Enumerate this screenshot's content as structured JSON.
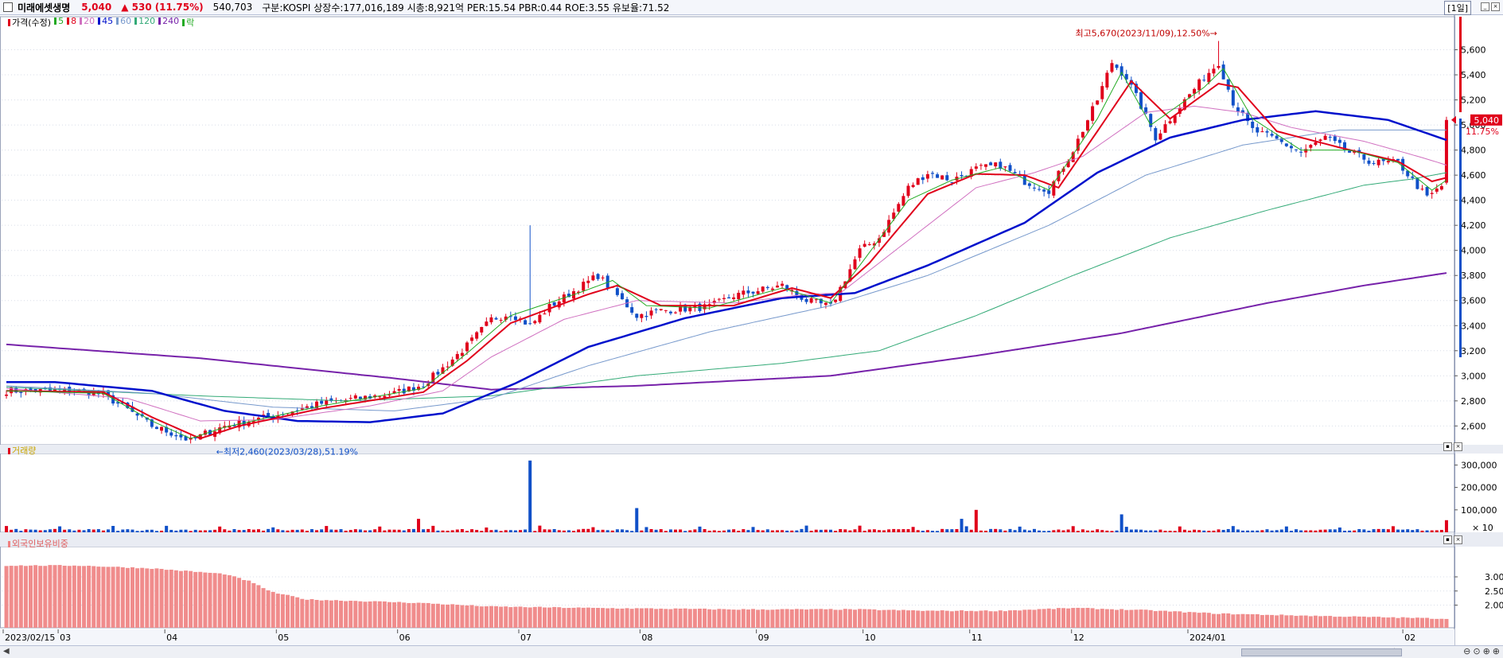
{
  "header": {
    "stock_name": "미래에셋생명",
    "price": "5,040",
    "change": "▲ 530",
    "change_pct": "(11.75%)",
    "volume": "540,703",
    "info": "구분:KOSPI  상장수:177,016,189  시총:8,921억  PER:15.54  PBR:0.44  ROE:3.55  유보율:71.52",
    "period": "[1일]"
  },
  "legend": {
    "price_label": "가격(수정)",
    "ma_items": [
      {
        "label": "5",
        "color": "#22aa22"
      },
      {
        "label": "8",
        "color": "#e0001b"
      },
      {
        "label": "20",
        "color": "#d070c0"
      },
      {
        "label": "45",
        "color": "#0011cc"
      },
      {
        "label": "60",
        "color": "#7799cc"
      },
      {
        "label": "120",
        "color": "#33aa77"
      },
      {
        "label": "240",
        "color": "#7722aa"
      },
      {
        "label": "락",
        "color": "#22aa22"
      }
    ]
  },
  "volume_panel": {
    "label": "거래량",
    "unit_label": "× 10"
  },
  "foreign_panel": {
    "label": "외국인보유비중"
  },
  "colors": {
    "up": "#e0001b",
    "down": "#1050c8",
    "bg": "#ffffff",
    "grid": "#d8dde8"
  },
  "chart_data": {
    "type": "candlestick",
    "x_labels": [
      "2023/02/15",
      "03",
      "04",
      "05",
      "06",
      "07",
      "08",
      "09",
      "10",
      "11",
      "12",
      "2024/01",
      "02"
    ],
    "price_axis": {
      "ylim": [
        2450,
        5800
      ],
      "ticks": [
        "2,600",
        "2,800",
        "3,000",
        "3,200",
        "3,400",
        "3,600",
        "3,800",
        "4,000",
        "4,200",
        "4,400",
        "4,600",
        "4,800",
        "5,000",
        "5,200",
        "5,400",
        "5,600"
      ]
    },
    "current_price": {
      "value": 5040,
      "label": "5,040",
      "pct": "11.75%"
    },
    "annotations": {
      "high": "최고5,670(2023/11/09),12.50%→",
      "low": "←최저2,460(2023/03/28),51.19%"
    },
    "close_anchors": [
      [
        0,
        2880
      ],
      [
        15,
        2880
      ],
      [
        20,
        2850
      ],
      [
        25,
        2730
      ],
      [
        30,
        2600
      ],
      [
        35,
        2530
      ],
      [
        38,
        2480
      ],
      [
        41,
        2540
      ],
      [
        45,
        2600
      ],
      [
        55,
        2680
      ],
      [
        65,
        2780
      ],
      [
        80,
        2860
      ],
      [
        86,
        2930
      ],
      [
        90,
        3060
      ],
      [
        95,
        3240
      ],
      [
        100,
        3450
      ],
      [
        104,
        3500
      ],
      [
        108,
        3400
      ],
      [
        112,
        3550
      ],
      [
        118,
        3700
      ],
      [
        122,
        3800
      ],
      [
        126,
        3640
      ],
      [
        130,
        3480
      ],
      [
        135,
        3520
      ],
      [
        145,
        3550
      ],
      [
        150,
        3640
      ],
      [
        160,
        3720
      ],
      [
        165,
        3600
      ],
      [
        170,
        3550
      ],
      [
        172,
        3700
      ],
      [
        176,
        4000
      ],
      [
        180,
        4100
      ],
      [
        186,
        4500
      ],
      [
        190,
        4620
      ],
      [
        195,
        4560
      ],
      [
        200,
        4650
      ],
      [
        205,
        4680
      ],
      [
        210,
        4550
      ],
      [
        215,
        4480
      ],
      [
        220,
        4800
      ],
      [
        225,
        5200
      ],
      [
        228,
        5500
      ],
      [
        231,
        5380
      ],
      [
        234,
        5150
      ],
      [
        237,
        4900
      ],
      [
        242,
        5150
      ],
      [
        247,
        5380
      ],
      [
        250,
        5500
      ],
      [
        253,
        5180
      ],
      [
        257,
        4960
      ],
      [
        262,
        4880
      ],
      [
        267,
        4780
      ],
      [
        272,
        4900
      ],
      [
        277,
        4780
      ],
      [
        282,
        4700
      ],
      [
        287,
        4700
      ],
      [
        290,
        4560
      ],
      [
        293,
        4420
      ],
      [
        296,
        4510
      ],
      [
        297,
        5040
      ]
    ],
    "ma_series": {
      "ma5": [
        [
          0,
          2880
        ],
        [
          20,
          2860
        ],
        [
          30,
          2640
        ],
        [
          38,
          2500
        ],
        [
          45,
          2590
        ],
        [
          65,
          2760
        ],
        [
          86,
          2900
        ],
        [
          95,
          3180
        ],
        [
          104,
          3480
        ],
        [
          118,
          3660
        ],
        [
          125,
          3760
        ],
        [
          132,
          3560
        ],
        [
          145,
          3540
        ],
        [
          160,
          3700
        ],
        [
          170,
          3580
        ],
        [
          176,
          3880
        ],
        [
          186,
          4400
        ],
        [
          195,
          4560
        ],
        [
          205,
          4660
        ],
        [
          215,
          4480
        ],
        [
          225,
          5050
        ],
        [
          230,
          5420
        ],
        [
          236,
          5000
        ],
        [
          247,
          5300
        ],
        [
          251,
          5450
        ],
        [
          257,
          5050
        ],
        [
          267,
          4800
        ],
        [
          277,
          4800
        ],
        [
          287,
          4700
        ],
        [
          294,
          4480
        ],
        [
          297,
          4560
        ]
      ],
      "ma8": [
        [
          0,
          2880
        ],
        [
          20,
          2870
        ],
        [
          30,
          2670
        ],
        [
          40,
          2500
        ],
        [
          48,
          2600
        ],
        [
          65,
          2740
        ],
        [
          86,
          2870
        ],
        [
          95,
          3120
        ],
        [
          104,
          3420
        ],
        [
          120,
          3650
        ],
        [
          126,
          3720
        ],
        [
          135,
          3560
        ],
        [
          150,
          3560
        ],
        [
          162,
          3700
        ],
        [
          170,
          3620
        ],
        [
          178,
          3900
        ],
        [
          190,
          4450
        ],
        [
          200,
          4610
        ],
        [
          210,
          4600
        ],
        [
          217,
          4500
        ],
        [
          225,
          4950
        ],
        [
          232,
          5350
        ],
        [
          240,
          5050
        ],
        [
          250,
          5330
        ],
        [
          254,
          5300
        ],
        [
          262,
          4950
        ],
        [
          275,
          4820
        ],
        [
          287,
          4710
        ],
        [
          294,
          4550
        ],
        [
          297,
          4580
        ]
      ],
      "ma20": [
        [
          0,
          2900
        ],
        [
          25,
          2820
        ],
        [
          40,
          2640
        ],
        [
          55,
          2650
        ],
        [
          75,
          2760
        ],
        [
          90,
          2880
        ],
        [
          100,
          3150
        ],
        [
          115,
          3450
        ],
        [
          130,
          3600
        ],
        [
          150,
          3580
        ],
        [
          165,
          3650
        ],
        [
          172,
          3660
        ],
        [
          185,
          4050
        ],
        [
          200,
          4500
        ],
        [
          212,
          4620
        ],
        [
          222,
          4750
        ],
        [
          235,
          5100
        ],
        [
          245,
          5150
        ],
        [
          255,
          5100
        ],
        [
          265,
          4980
        ],
        [
          280,
          4870
        ],
        [
          292,
          4740
        ],
        [
          297,
          4680
        ]
      ],
      "ma45": [
        [
          0,
          2950
        ],
        [
          10,
          2950
        ],
        [
          30,
          2880
        ],
        [
          45,
          2720
        ],
        [
          60,
          2640
        ],
        [
          75,
          2630
        ],
        [
          90,
          2700
        ],
        [
          105,
          2940
        ],
        [
          120,
          3230
        ],
        [
          140,
          3460
        ],
        [
          160,
          3620
        ],
        [
          175,
          3660
        ],
        [
          190,
          3880
        ],
        [
          210,
          4220
        ],
        [
          225,
          4620
        ],
        [
          240,
          4900
        ],
        [
          255,
          5040
        ],
        [
          270,
          5110
        ],
        [
          285,
          5040
        ],
        [
          297,
          4880
        ]
      ],
      "ma60": [
        [
          0,
          2920
        ],
        [
          30,
          2860
        ],
        [
          55,
          2750
        ],
        [
          80,
          2720
        ],
        [
          100,
          2820
        ],
        [
          120,
          3080
        ],
        [
          145,
          3350
        ],
        [
          170,
          3560
        ],
        [
          190,
          3800
        ],
        [
          215,
          4200
        ],
        [
          235,
          4600
        ],
        [
          255,
          4840
        ],
        [
          275,
          4960
        ],
        [
          297,
          4960
        ]
      ],
      "ma120": [
        [
          0,
          2910
        ],
        [
          40,
          2840
        ],
        [
          70,
          2800
        ],
        [
          100,
          2840
        ],
        [
          130,
          3000
        ],
        [
          160,
          3100
        ],
        [
          180,
          3200
        ],
        [
          200,
          3480
        ],
        [
          220,
          3800
        ],
        [
          240,
          4100
        ],
        [
          260,
          4320
        ],
        [
          280,
          4520
        ],
        [
          290,
          4570
        ],
        [
          297,
          4620
        ]
      ],
      "ma240": [
        [
          0,
          3250
        ],
        [
          40,
          3140
        ],
        [
          80,
          2980
        ],
        [
          100,
          2890
        ],
        [
          130,
          2920
        ],
        [
          170,
          3000
        ],
        [
          200,
          3160
        ],
        [
          230,
          3340
        ],
        [
          260,
          3580
        ],
        [
          280,
          3720
        ],
        [
          297,
          3820
        ]
      ]
    },
    "volume_axis": {
      "ylim": [
        0,
        330000
      ],
      "ticks": [
        "100,000",
        "200,000",
        "300,000"
      ]
    },
    "foreign_axis": {
      "ylim": [
        1.2,
        3.9
      ],
      "ticks": [
        "2.00",
        "2.50",
        "3.00"
      ]
    },
    "foreign_anchors": [
      [
        0,
        3.4
      ],
      [
        15,
        3.4
      ],
      [
        30,
        3.3
      ],
      [
        45,
        3.1
      ],
      [
        50,
        2.85
      ],
      [
        55,
        2.45
      ],
      [
        62,
        2.2
      ],
      [
        72,
        2.15
      ],
      [
        85,
        2.08
      ],
      [
        100,
        1.95
      ],
      [
        120,
        1.9
      ],
      [
        150,
        1.85
      ],
      [
        175,
        1.85
      ],
      [
        190,
        1.8
      ],
      [
        205,
        1.8
      ],
      [
        220,
        1.9
      ],
      [
        235,
        1.82
      ],
      [
        250,
        1.7
      ],
      [
        270,
        1.62
      ],
      [
        290,
        1.55
      ],
      [
        297,
        1.52
      ]
    ]
  }
}
